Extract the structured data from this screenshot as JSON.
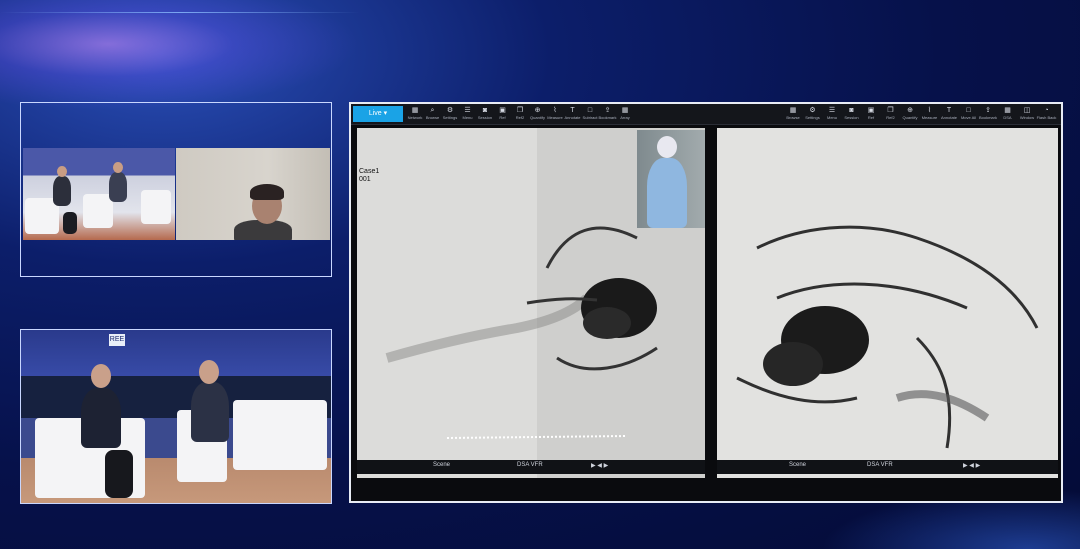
{
  "colors": {
    "accent": "#1aa3e6",
    "frame": "#c9d7ff",
    "background": "#06114a"
  },
  "stage": {
    "nameplate": "REE"
  },
  "dsa": {
    "live_label": "Live ▾",
    "case_label": "Case1",
    "case_sub": "001",
    "toolbar_left": [
      {
        "icon": "grid-icon",
        "label": "Network"
      },
      {
        "icon": "search-icon",
        "label": "Browse"
      },
      {
        "icon": "gear-icon",
        "label": "Settings"
      },
      {
        "icon": "menu-icon",
        "label": "Menu"
      },
      {
        "icon": "camera-icon",
        "label": "Session"
      },
      {
        "icon": "save-icon",
        "label": "Ref"
      },
      {
        "icon": "copy-icon",
        "label": "Ref2"
      },
      {
        "icon": "zoom-icon",
        "label": "Quantify"
      },
      {
        "icon": "ruler-icon",
        "label": "Measure"
      },
      {
        "icon": "text-icon",
        "label": "Annotate"
      },
      {
        "icon": "square-icon",
        "label": "Subtract"
      },
      {
        "icon": "export-icon",
        "label": "Bookmark"
      },
      {
        "icon": "grid-icon",
        "label": "Array"
      }
    ],
    "toolbar_right": [
      {
        "icon": "grid-icon",
        "label": "Browse"
      },
      {
        "icon": "gear-icon",
        "label": "Settings"
      },
      {
        "icon": "menu-icon",
        "label": "Menu"
      },
      {
        "icon": "camera-icon",
        "label": "Session"
      },
      {
        "icon": "save-icon",
        "label": "Ref"
      },
      {
        "icon": "copy-icon",
        "label": "Ref2"
      },
      {
        "icon": "zoom-icon",
        "label": "Quantify"
      },
      {
        "icon": "ruler-icon",
        "label": "Measure"
      },
      {
        "icon": "text-icon",
        "label": "Annotate"
      },
      {
        "icon": "square-icon",
        "label": "Move All"
      },
      {
        "icon": "export-icon",
        "label": "Bookmark"
      },
      {
        "icon": "grid-icon",
        "label": "DSA"
      },
      {
        "icon": "window-icon",
        "label": "Window"
      },
      {
        "icon": "clock-icon",
        "label": "Flash Back"
      }
    ],
    "left_footer": {
      "scene": "Scene",
      "mode": "DSA VFR"
    },
    "right_footer": {
      "scene": "Scene",
      "mode": "DSA VFR"
    }
  }
}
